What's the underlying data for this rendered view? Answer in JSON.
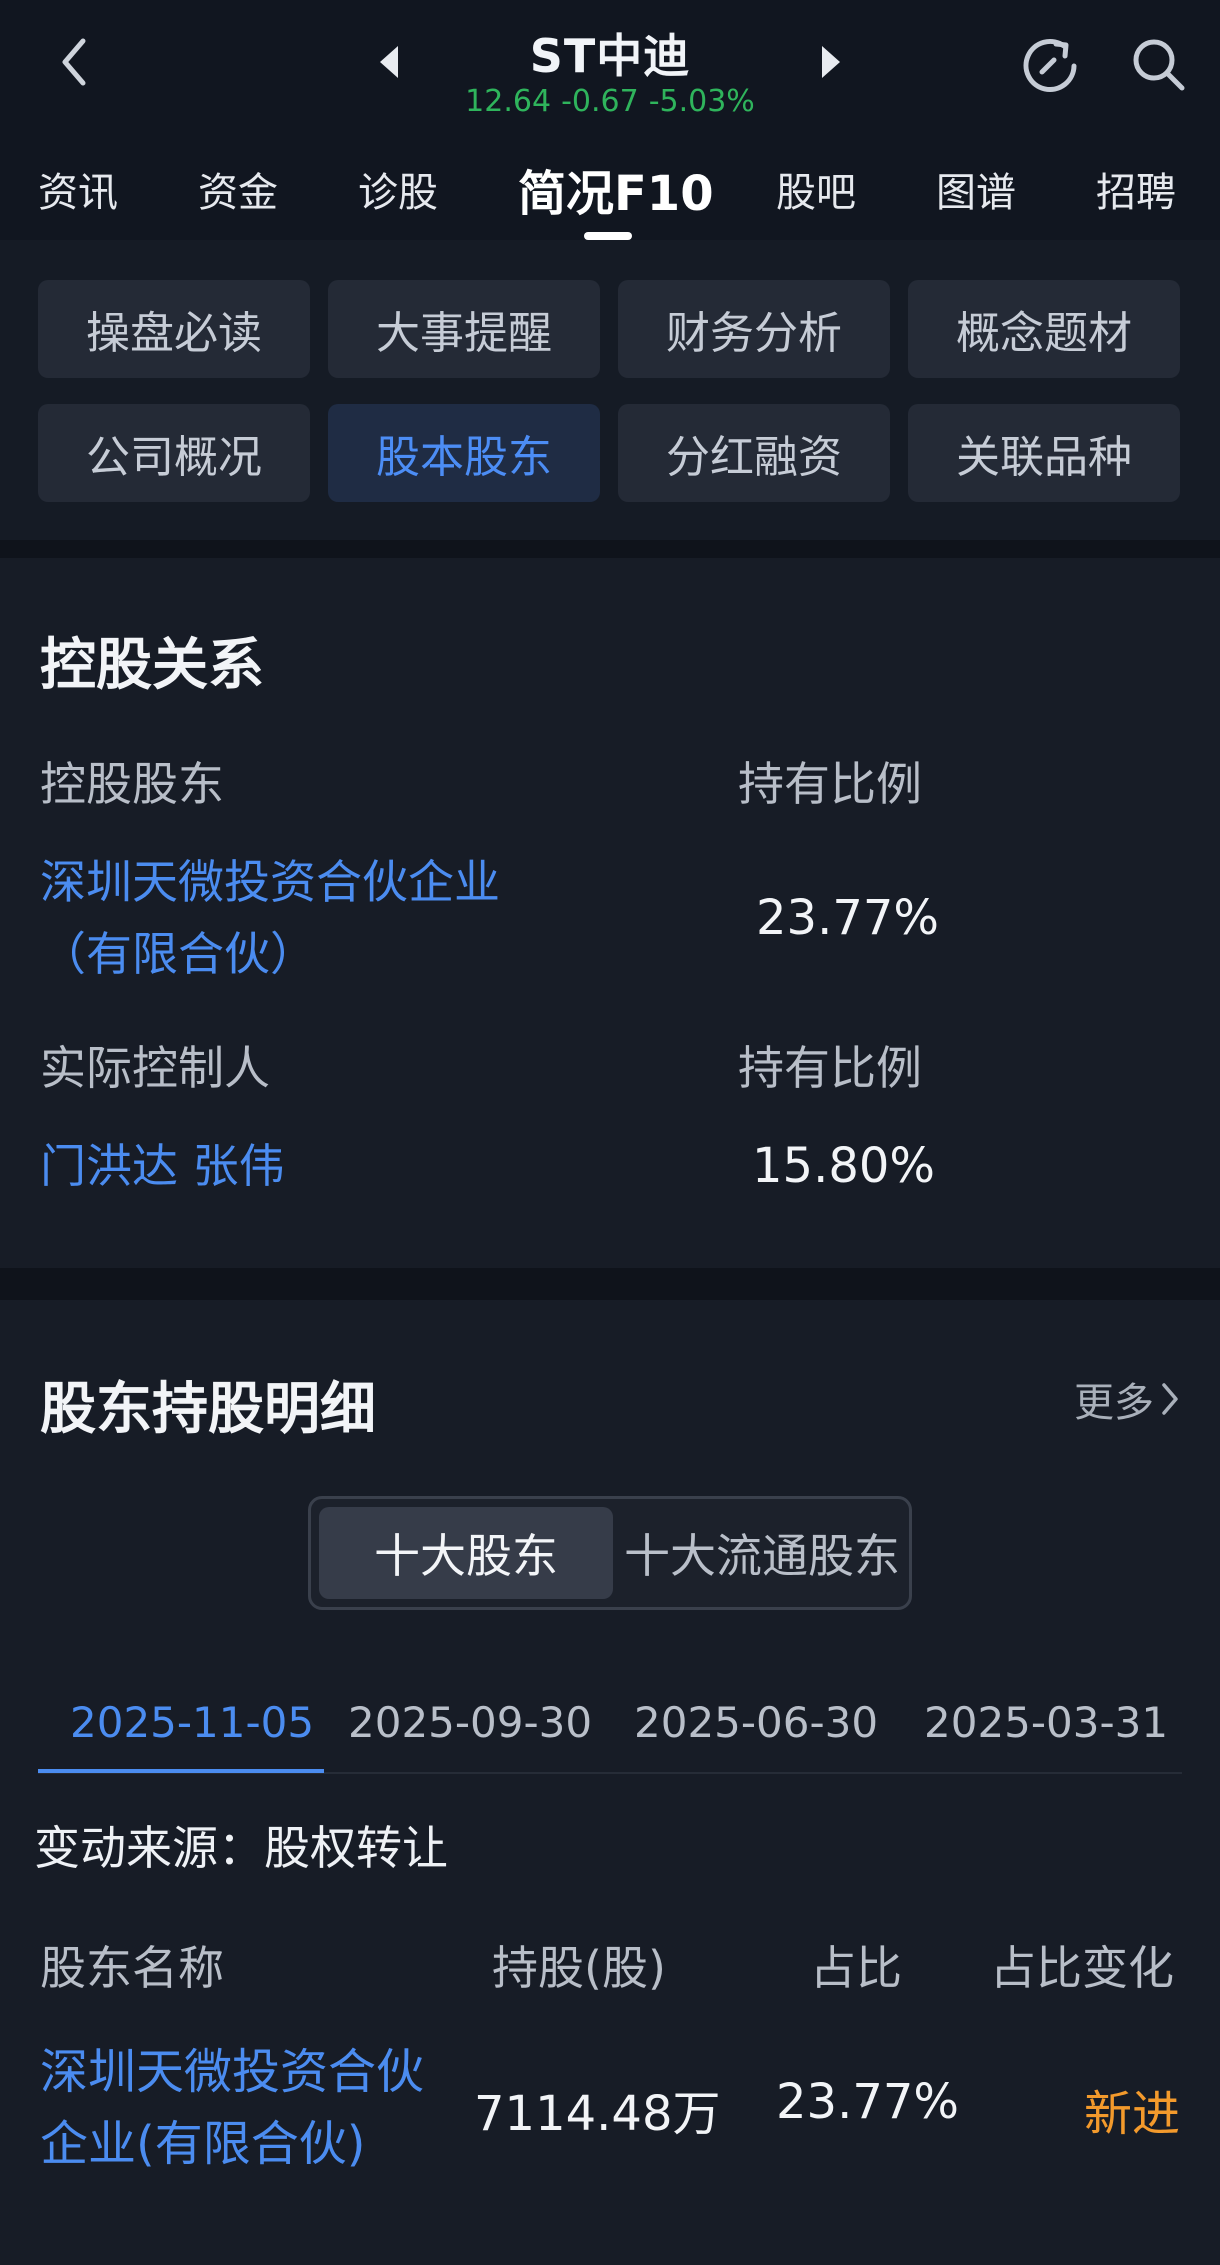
{
  "header": {
    "title": "ST中迪",
    "price": "12.64",
    "change": "-0.67",
    "change_pct": "-5.03%",
    "quote_color": "#2fb45c"
  },
  "tabs": [
    {
      "label": "资讯"
    },
    {
      "label": "资金"
    },
    {
      "label": "诊股"
    },
    {
      "label": "简况F10",
      "active": true
    },
    {
      "label": "股吧"
    },
    {
      "label": "图谱"
    },
    {
      "label": "招聘"
    }
  ],
  "subnav": [
    {
      "label": "操盘必读"
    },
    {
      "label": "大事提醒"
    },
    {
      "label": "财务分析"
    },
    {
      "label": "概念题材"
    },
    {
      "label": "公司概况"
    },
    {
      "label": "股本股东",
      "active": true
    },
    {
      "label": "分红融资"
    },
    {
      "label": "关联品种"
    }
  ],
  "control": {
    "title": "控股关系",
    "holder_label": "控股股东",
    "ratio_label": "持有比例",
    "holder_name": "深圳天微投资合伙企业（有限合伙）",
    "holder_ratio": "23.77%",
    "actual_label": "实际控制人",
    "actual_ratio_label": "持有比例",
    "actual_name": "门洪达 张伟",
    "actual_ratio": "15.80%"
  },
  "holders": {
    "title": "股东持股明细",
    "more": "更多",
    "segments": [
      "十大股东",
      "十大流通股东"
    ],
    "dates": [
      "2025-11-05",
      "2025-09-30",
      "2025-06-30",
      "2025-03-31"
    ],
    "source": "变动来源：股权转让",
    "columns": [
      "股东名称",
      "持股(股)",
      "占比",
      "占比变化"
    ],
    "rows": [
      {
        "name": "深圳天微投资合伙企业(有限合伙)",
        "shares": "7114.48万",
        "pct": "23.77%",
        "change": "新进"
      }
    ]
  },
  "colors": {
    "accent": "#4b8cf0",
    "new_badge": "#f39a2c",
    "background": "#0f131b"
  }
}
